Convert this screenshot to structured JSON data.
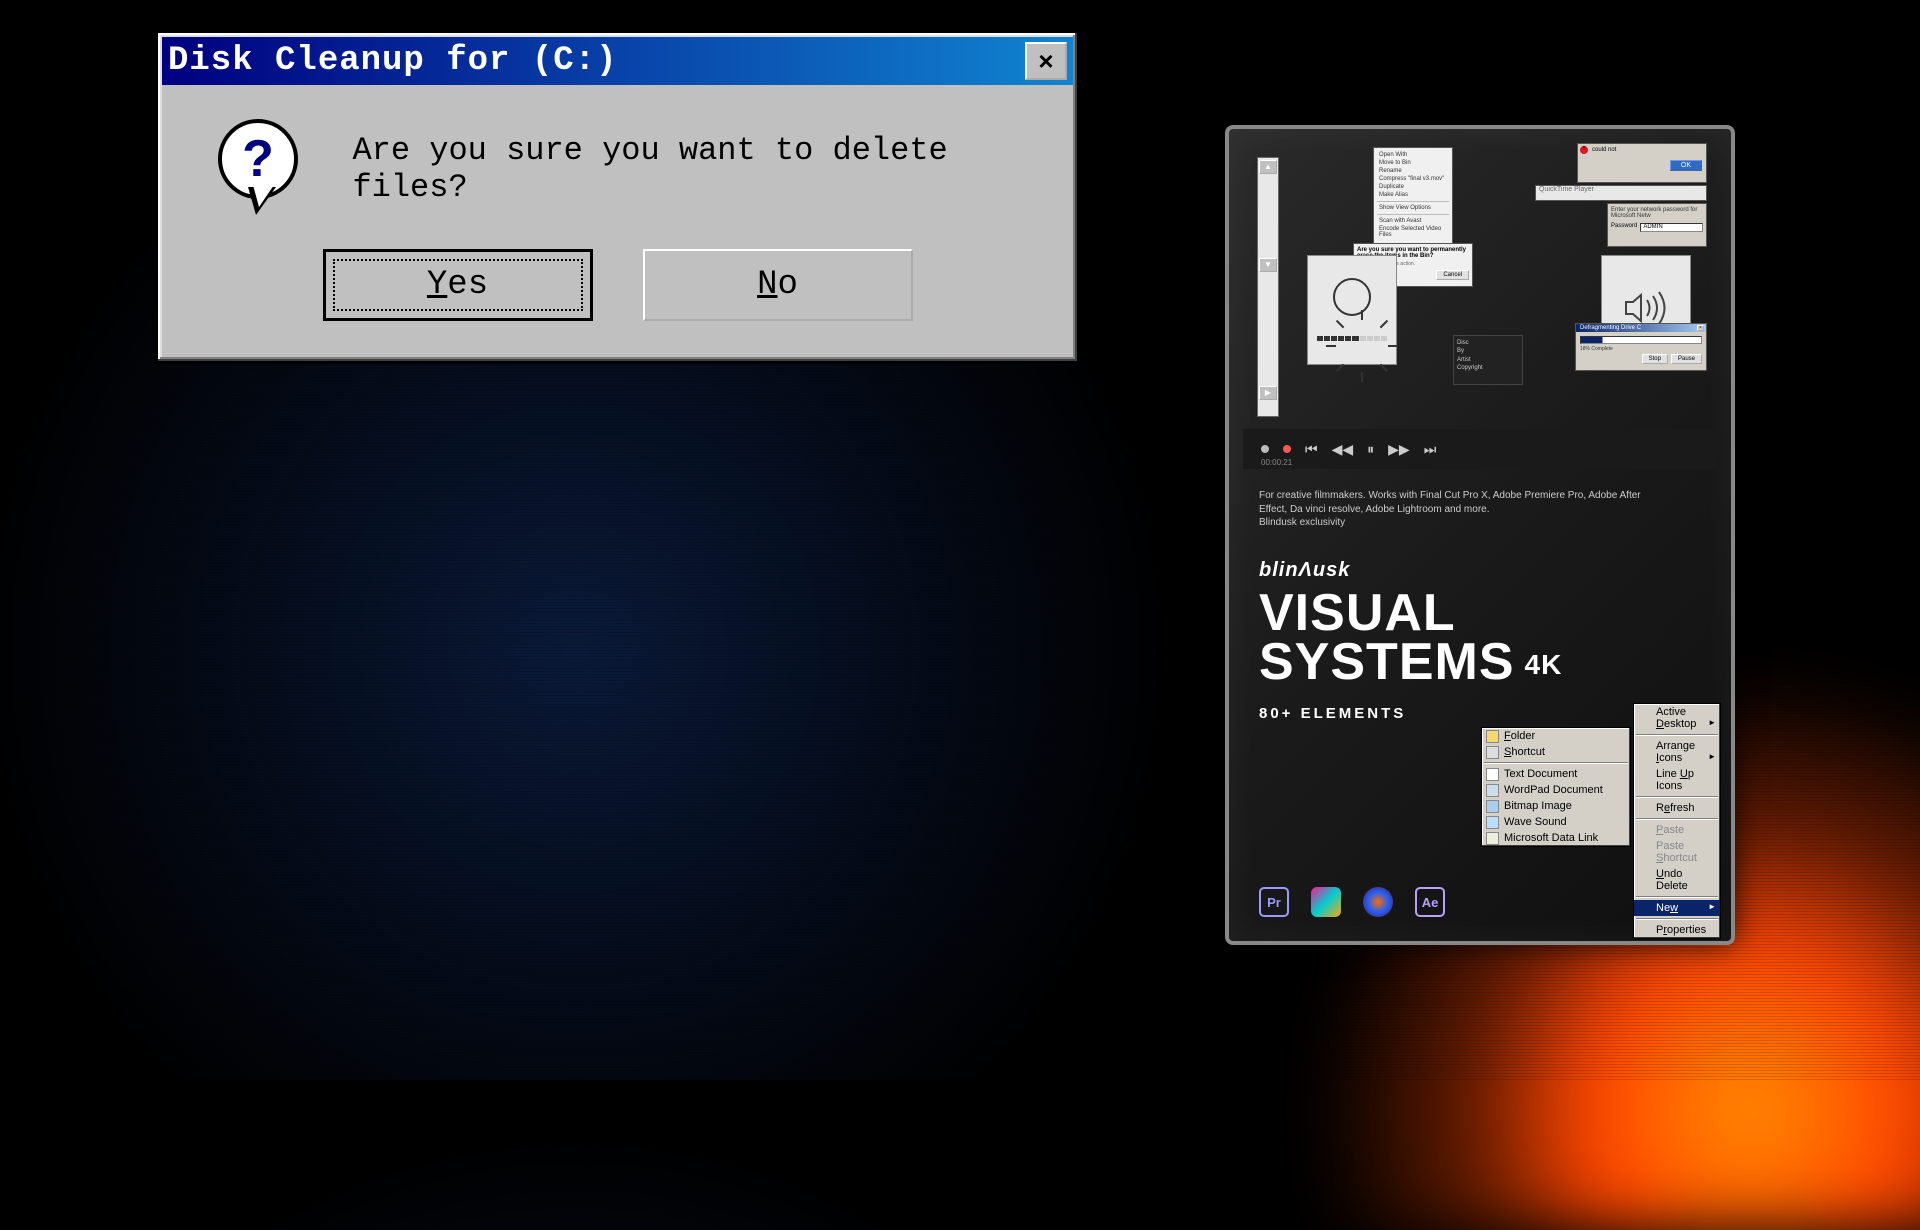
{
  "dialog": {
    "title": "Disk Cleanup for  (C:)",
    "close_x": "×",
    "message": "Are you sure you want to delete files?",
    "yes_label": "Yes",
    "no_label": "No",
    "qmark": "?"
  },
  "product": {
    "brand": "blinɅusk",
    "title_line1": "VISUAL",
    "title_line2": "SYSTEMS",
    "fourk": "4K",
    "subtitle": "80+ ELEMENTS",
    "copy_line1": "For creative filmmakers. Works with Final Cut Pro X, Adobe Premiere Pro, Adobe After",
    "copy_line2": "Effect, Da vinci resolve, Adobe Lightroom and more.",
    "copy_line3": "Blindusk exclusivity",
    "media": {
      "timecode": "00:00:21",
      "symbols": {
        "prev": "⏮",
        "rew": "◀◀",
        "play": "⏸",
        "fwd": "▶▶",
        "next": "⏭"
      }
    },
    "collage": {
      "ok": "OK",
      "cancel": "Cancel",
      "error_title": "could not",
      "defrag_title": "Defragmenting Drive C",
      "password_label": "Password",
      "qt_text": "QuickTime Player",
      "menu_items": [
        "Open With",
        "Move to Bin",
        "Rename",
        "Compress \"final v3.mov\"",
        "Duplicate",
        "Make Alias",
        "",
        "Show View Options",
        "",
        "Scan with Avast",
        "Encode Selected Video Files"
      ],
      "confirm_text": "Are you sure you want to permanently erase the items in the Bin?",
      "undo_text": "You can't undo this action.",
      "disc_labels": [
        "Disc",
        "By",
        "Artist",
        "Copyright"
      ]
    },
    "context_right": [
      {
        "label": "Active Desktop",
        "arrow": true,
        "u": "D"
      },
      {
        "sep": true
      },
      {
        "label": "Arrange Icons",
        "arrow": true,
        "u": "I"
      },
      {
        "label": "Line Up Icons",
        "u": "U"
      },
      {
        "sep": true
      },
      {
        "label": "Refresh",
        "u": "e"
      },
      {
        "sep": true
      },
      {
        "label": "Paste",
        "dis": true,
        "u": "P"
      },
      {
        "label": "Paste Shortcut",
        "dis": true,
        "u": "S"
      },
      {
        "label": "Undo Delete",
        "u": "U"
      },
      {
        "sep": true
      },
      {
        "label": "New",
        "hi": true,
        "arrow": true,
        "u": "w"
      },
      {
        "sep": true
      },
      {
        "label": "Properties",
        "u": "r"
      }
    ],
    "context_left": [
      {
        "label": "Folder",
        "icon": "folder",
        "u": "F"
      },
      {
        "label": "Shortcut",
        "icon": "shortcut",
        "u": "S"
      },
      {
        "sep": true
      },
      {
        "label": "Text Document",
        "icon": "txt"
      },
      {
        "label": "WordPad Document",
        "icon": "doc"
      },
      {
        "label": "Bitmap Image",
        "icon": "bmp"
      },
      {
        "label": "Wave Sound",
        "icon": "wav"
      },
      {
        "label": "Microsoft Data Link",
        "icon": "link"
      }
    ],
    "app_icons": {
      "pr": "Pr",
      "ae": "Ae"
    }
  }
}
